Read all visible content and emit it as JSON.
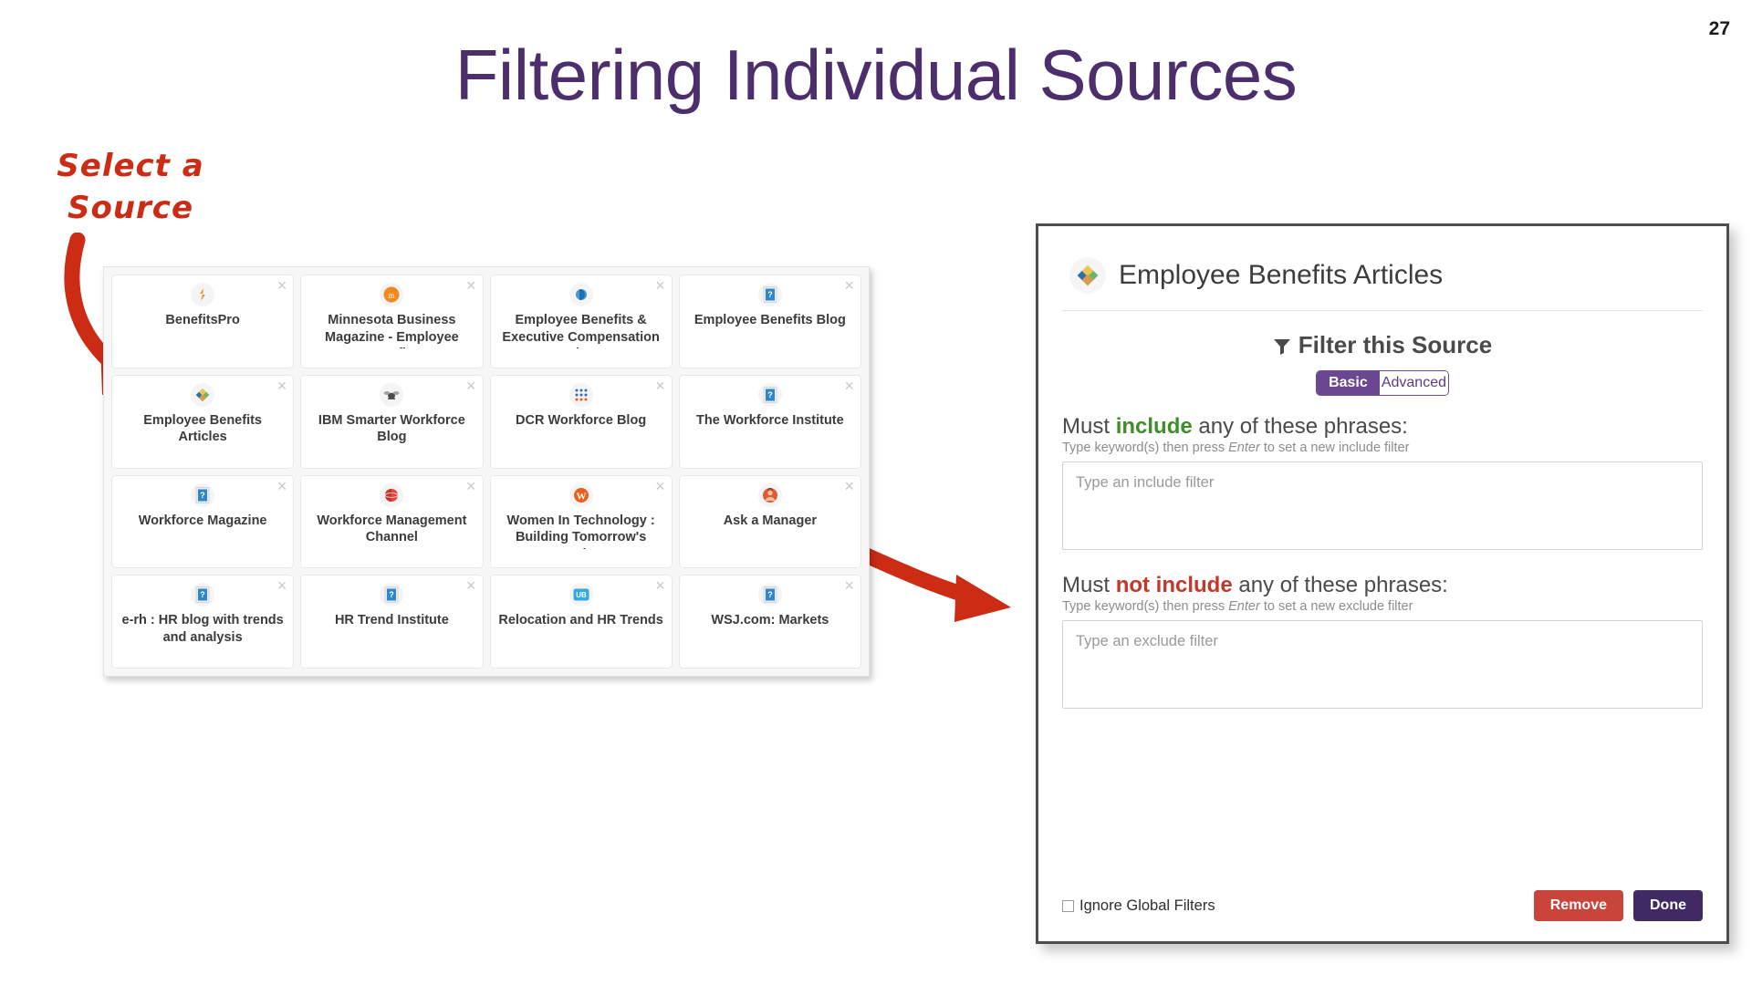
{
  "slide": {
    "number": "27",
    "title": "Filtering Individual Sources",
    "annotation_line1": "Select a",
    "annotation_line2": "Source",
    "title_color": "#4b2e6b",
    "annotation_color": "#cc2b14"
  },
  "sources": [
    {
      "name": "BenefitsPro",
      "icon": "benefitspro-favicon",
      "close": "×"
    },
    {
      "name": "Minnesota Business Magazine - Employee Benefits",
      "icon": "minnesota-business-favicon",
      "close": "×"
    },
    {
      "name": "Employee Benefits & Executive Compensation Blog",
      "icon": "employee-benefits-exec-favicon",
      "close": "×"
    },
    {
      "name": "Employee Benefits Blog",
      "icon": "generic-page-favicon",
      "close": "×"
    },
    {
      "name": "Employee Benefits Articles",
      "icon": "diamond-favicon",
      "close": "×"
    },
    {
      "name": "IBM Smarter Workforce Blog",
      "icon": "ibm-bee-favicon",
      "close": "×"
    },
    {
      "name": "DCR Workforce Blog",
      "icon": "dcr-dots-favicon",
      "close": "×"
    },
    {
      "name": "The Workforce Institute",
      "icon": "generic-page-favicon",
      "close": "×"
    },
    {
      "name": "Workforce Magazine",
      "icon": "generic-page-favicon",
      "close": "×"
    },
    {
      "name": "Workforce Management Channel",
      "icon": "red-sphere-favicon",
      "close": "×"
    },
    {
      "name": "Women In Technology : Building Tomorrow's Leaders",
      "icon": "w-circle-favicon",
      "close": "×"
    },
    {
      "name": "Ask a Manager",
      "icon": "ask-manager-favicon",
      "close": "×"
    },
    {
      "name": "e-rh : HR blog with trends and analysis",
      "icon": "generic-page-favicon",
      "close": "×"
    },
    {
      "name": "HR Trend Institute",
      "icon": "generic-page-favicon",
      "close": "×"
    },
    {
      "name": "Relocation and HR Trends",
      "icon": "ub-favicon",
      "close": "×"
    },
    {
      "name": "WSJ.com: Markets",
      "icon": "generic-page-favicon",
      "close": "×"
    }
  ],
  "dialog": {
    "title": "Employee Benefits Articles",
    "site_icon": "diamond-favicon",
    "filter_heading": "Filter this Source",
    "funnel_icon": "▼",
    "toggle": {
      "basic": "Basic",
      "advanced": "Advanced",
      "selected": "Basic",
      "active_color": "#6b4792"
    },
    "include": {
      "label_pre": "Must ",
      "label_key": "include",
      "label_post": " any of these phrases:",
      "hint_pre": "Type keyword(s) then press ",
      "hint_em": "Enter",
      "hint_post": " to set a new include filter",
      "placeholder": "Type an include filter",
      "value": "",
      "key_color": "#3f8f29"
    },
    "exclude": {
      "label_pre": "Must ",
      "label_key": "not include",
      "label_post": " any of these phrases:",
      "hint_pre": "Type keyword(s) then press ",
      "hint_em": "Enter",
      "hint_post": " to set a new exclude filter",
      "placeholder": "Type an exclude filter",
      "value": "",
      "key_color": "#c0392b"
    },
    "footer": {
      "ignore_label": "Ignore Global Filters",
      "ignore_checked": false,
      "remove_label": "Remove",
      "done_label": "Done",
      "remove_color": "#c9453c",
      "done_color": "#3f2a63"
    }
  }
}
